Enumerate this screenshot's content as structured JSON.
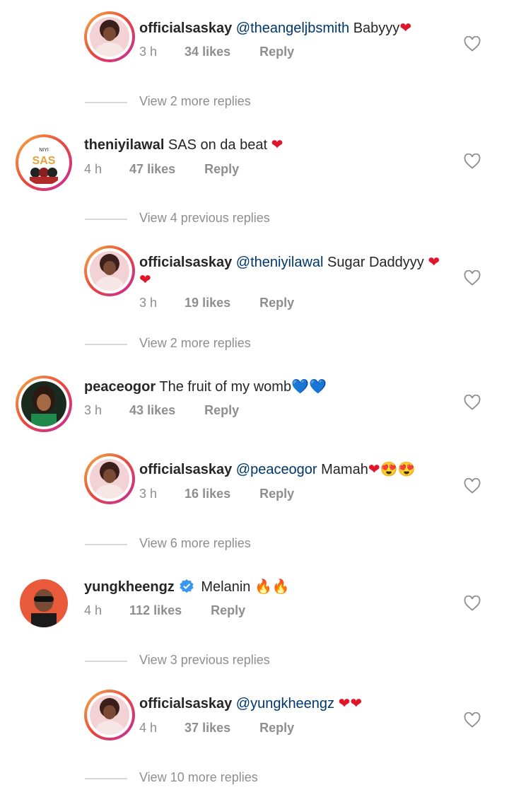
{
  "comments": [
    {
      "user": "officialsaskay",
      "mention": "@theangeljbsmith",
      "text": " Babyyy",
      "emoji": "❤",
      "time": "3 h",
      "likes": "34 likes",
      "reply": "Reply"
    },
    {
      "view_more": "View 2 more replies"
    },
    {
      "user": "theniyilawal",
      "text": " SAS on da beat ",
      "emoji": "❤",
      "time": "4 h",
      "likes": "47 likes",
      "reply": "Reply"
    },
    {
      "view_more": "View 4 previous replies"
    },
    {
      "user": "officialsaskay",
      "mention": "@theniyilawal",
      "text": " Sugar Daddyyy ",
      "emoji": "❤",
      "emoji2": "❤",
      "time": "3 h",
      "likes": "19 likes",
      "reply": "Reply"
    },
    {
      "view_more": "View 2 more replies"
    },
    {
      "user": "peaceogor",
      "text": " The fruit of my womb",
      "emoji": "💙💙",
      "time": "3 h",
      "likes": "43 likes",
      "reply": "Reply"
    },
    {
      "user": "officialsaskay",
      "mention": "@peaceogor",
      "text": " Mamah",
      "emoji": "❤😍😍",
      "time": "3 h",
      "likes": "16 likes",
      "reply": "Reply"
    },
    {
      "view_more": "View 6 more replies"
    },
    {
      "user": "yungkheengz",
      "text": " Melanin ",
      "emoji": "🔥🔥",
      "time": "4 h",
      "likes": "112 likes",
      "reply": "Reply"
    },
    {
      "view_more": "View 3 previous replies"
    },
    {
      "user": "officialsaskay",
      "mention": "@yungkheengz",
      "text": " ",
      "emoji": "❤❤",
      "time": "4 h",
      "likes": "37 likes",
      "reply": "Reply"
    },
    {
      "view_more": "View 10 more replies"
    }
  ],
  "avatar_colors": {
    "ring_start": "#f5b042",
    "ring_mid": "#e8473d",
    "ring_end": "#c32aa3",
    "verified": "#3897f0",
    "heart_emoji": "#e0142b",
    "blue_heart": "#1e88e5"
  }
}
